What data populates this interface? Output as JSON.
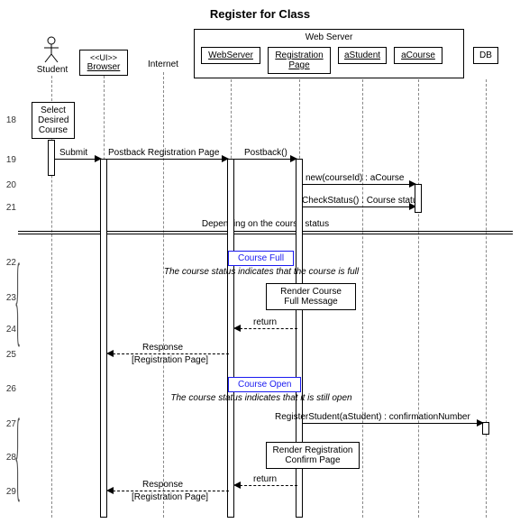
{
  "title": "Register for Class",
  "lanes": {
    "student": {
      "label": "Student"
    },
    "browser": {
      "stereo": "<<UI>>",
      "label": "Browser"
    },
    "internet": {
      "label": "Internet"
    },
    "server_group": {
      "label": "Web Server"
    },
    "webserver": {
      "label": "WebServer"
    },
    "regpage": {
      "label": "Registration Page"
    },
    "astudent": {
      "label": "aStudent"
    },
    "acourse": {
      "label": "aCourse"
    },
    "db": {
      "label": "DB"
    }
  },
  "rows": {
    "r18": "18",
    "r19": "19",
    "r20": "20",
    "r21": "21",
    "r22": "22",
    "r23": "23",
    "r24": "24",
    "r25": "25",
    "r26": "26",
    "r27": "27",
    "r28": "28",
    "r29": "29"
  },
  "messages": {
    "select_course": "Select Desired Course",
    "submit": "Submit",
    "postback_page": "Postback Registration Page",
    "postback_call": "Postback()",
    "new_course": "new(courseId) : aCourse",
    "check_status": "CheckStatus() : Course status",
    "depending": "Depending on the course status",
    "course_full_tag": "Course Full",
    "course_full_note": "The course status indicates that the course is full",
    "render_full": "Render Course Full Message",
    "return1": "return",
    "response1": "Response",
    "response1_sub": "[Registration Page]",
    "course_open_tag": "Course Open",
    "course_open_note": "The course status indicates that it is still open",
    "register_student": "RegisterStudent(aStudent) : confirmationNumber",
    "render_confirm": "Render Registration Confirm Page",
    "return2": "return",
    "response2": "Response",
    "response2_sub": "[Registration Page]"
  },
  "chart_data": {
    "type": "table",
    "diagram": "UML sequence diagram",
    "title": "Register for Class",
    "lifelines": [
      "Student",
      "Browser",
      "Internet",
      "WebServer",
      "Registration Page",
      "aStudent",
      "aCourse",
      "DB"
    ],
    "group": {
      "name": "Web Server",
      "contains": [
        "WebServer",
        "Registration Page",
        "aStudent",
        "aCourse"
      ]
    },
    "interactions": [
      {
        "row": 18,
        "from": "Student",
        "to": "Student",
        "type": "self",
        "label": "Select Desired Course"
      },
      {
        "row": 19,
        "from": "Student",
        "to": "Browser",
        "type": "sync",
        "label": "Submit"
      },
      {
        "row": 19,
        "from": "Browser",
        "to": "WebServer",
        "type": "sync",
        "label": "Postback Registration Page"
      },
      {
        "row": 19,
        "from": "WebServer",
        "to": "Registration Page",
        "type": "sync",
        "label": "Postback()"
      },
      {
        "row": 20,
        "from": "Registration Page",
        "to": "aCourse",
        "type": "sync",
        "label": "new(courseId) : aCourse"
      },
      {
        "row": 21,
        "from": "Registration Page",
        "to": "aCourse",
        "type": "sync",
        "label": "CheckStatus() : Course status"
      },
      {
        "row": null,
        "type": "divider",
        "label": "Depending on the course status"
      },
      {
        "row": 22,
        "type": "alt-fragment",
        "label": "Course Full",
        "guard": "The course status indicates that the course is full"
      },
      {
        "row": 23,
        "from": "Registration Page",
        "to": "Registration Page",
        "type": "self",
        "label": "Render Course Full Message"
      },
      {
        "row": 24,
        "from": "Registration Page",
        "to": "WebServer",
        "type": "return",
        "label": "return"
      },
      {
        "row": 25,
        "from": "WebServer",
        "to": "Browser",
        "type": "return",
        "label": "Response",
        "guard": "[Registration Page]"
      },
      {
        "row": 26,
        "type": "alt-fragment",
        "label": "Course Open",
        "guard": "The course status indicates that it is still open"
      },
      {
        "row": 27,
        "from": "Registration Page",
        "to": "DB",
        "type": "sync",
        "label": "RegisterStudent(aStudent) : confirmationNumber"
      },
      {
        "row": 28,
        "from": "Registration Page",
        "to": "Registration Page",
        "type": "self",
        "label": "Render Registration Confirm Page"
      },
      {
        "row": 29,
        "from": "Registration Page",
        "to": "WebServer",
        "type": "return",
        "label": "return"
      },
      {
        "row": 29,
        "from": "WebServer",
        "to": "Browser",
        "type": "return",
        "label": "Response",
        "guard": "[Registration Page]"
      }
    ]
  }
}
